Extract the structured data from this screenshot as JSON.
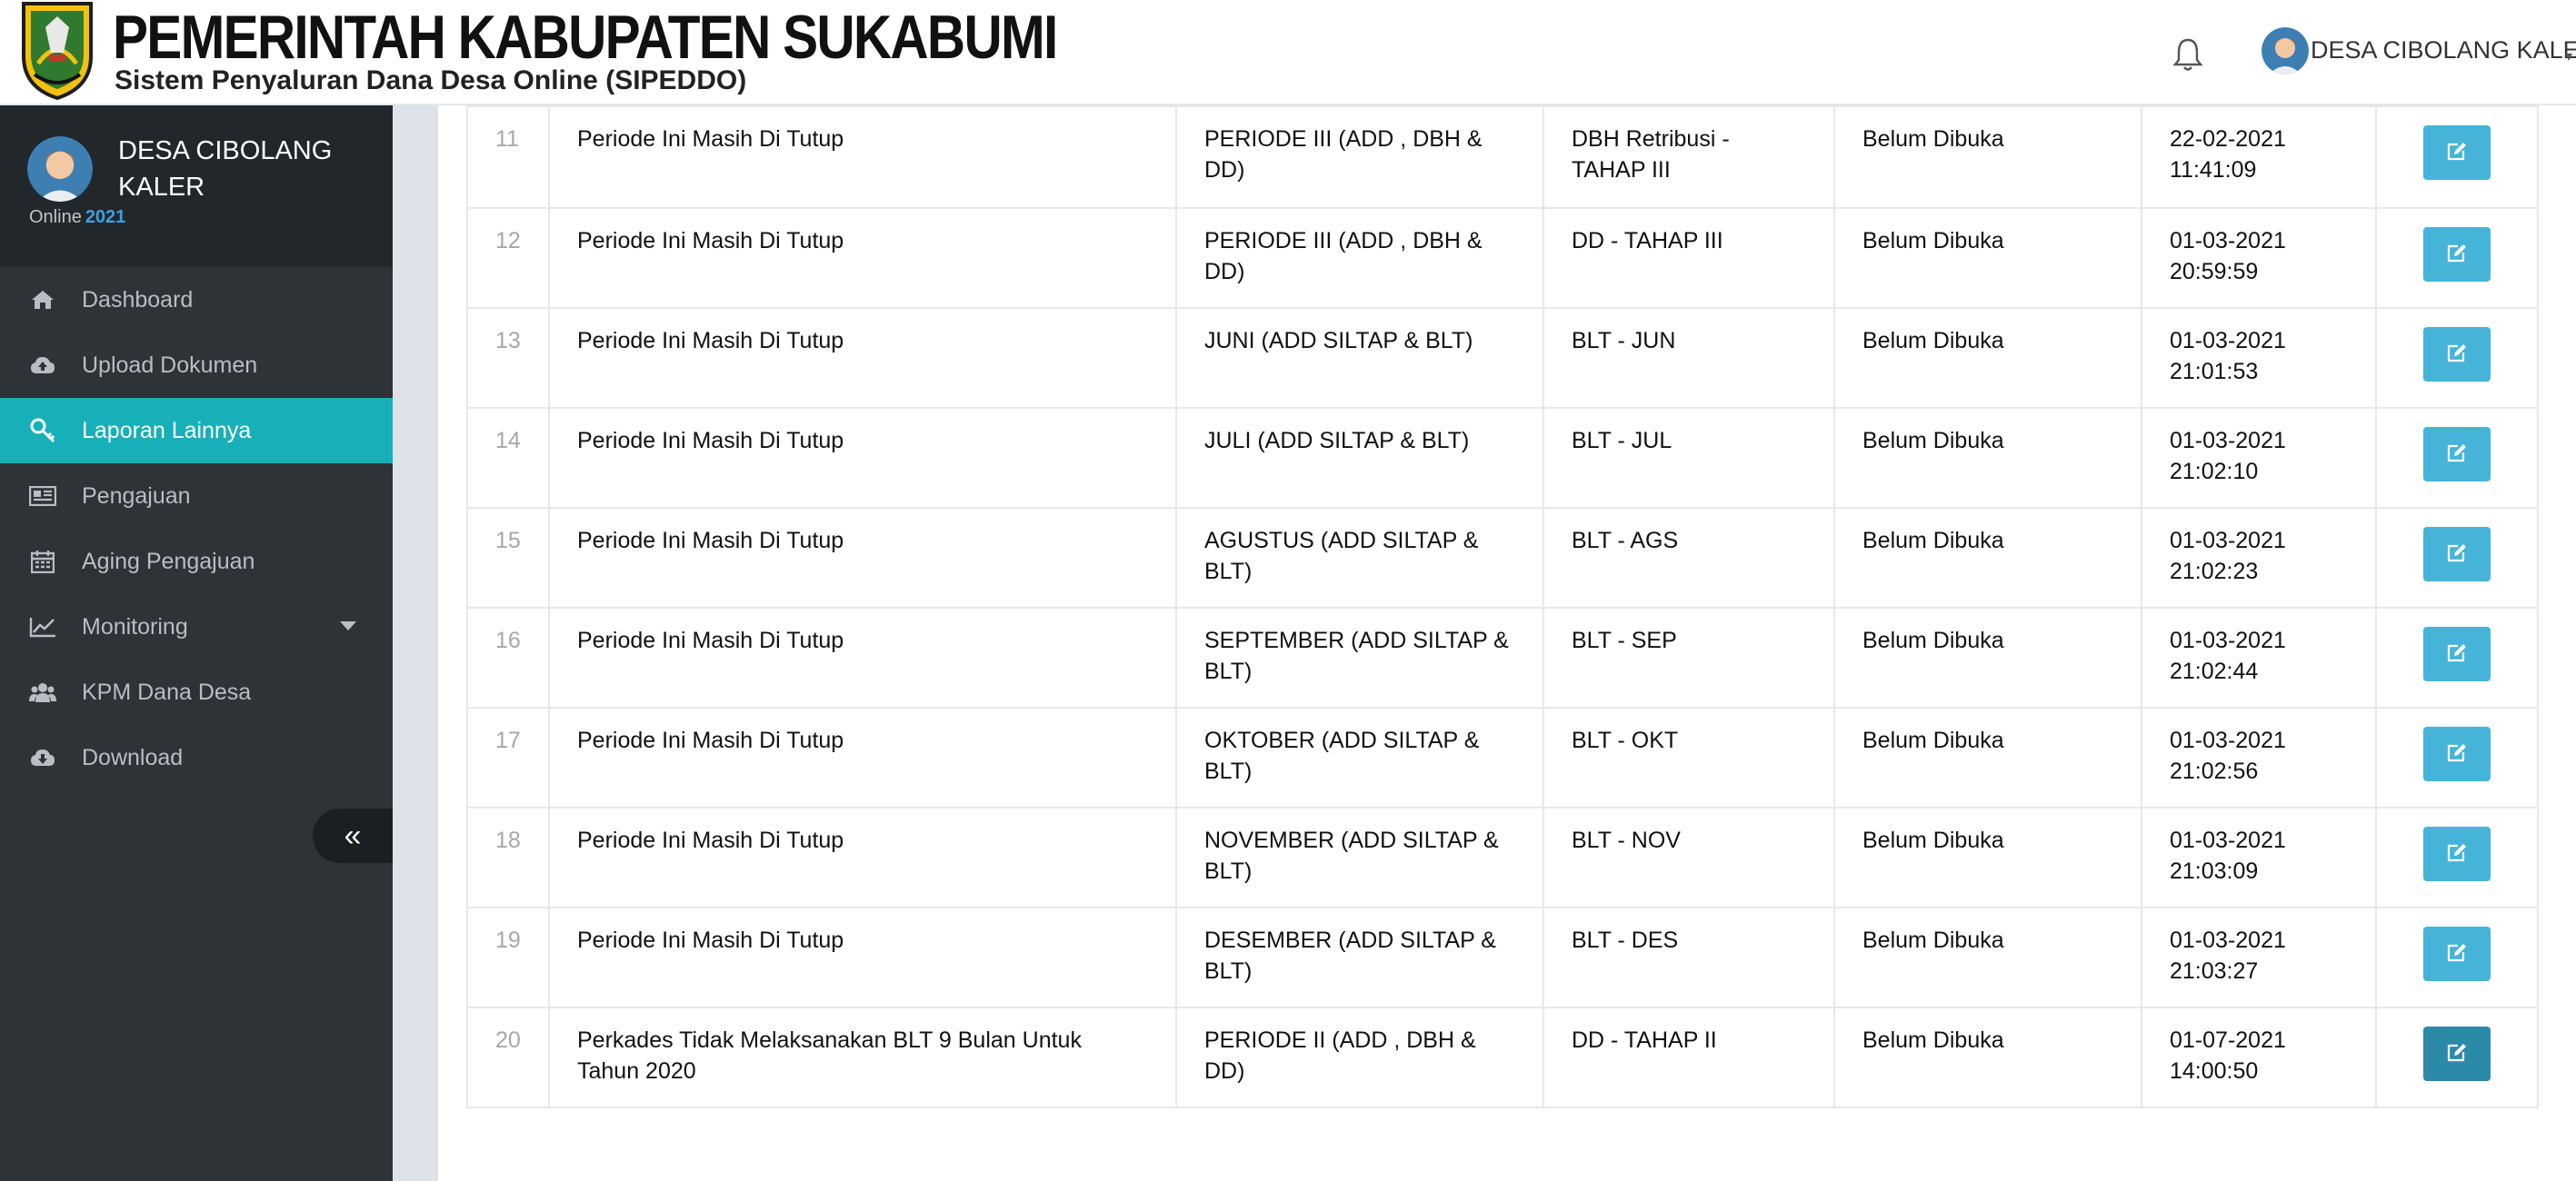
{
  "header": {
    "title": "PEMERINTAH KABUPATEN SUKABUMI",
    "subtitle": "Sistem Penyaluran Dana Desa Online (SIPEDDO)",
    "user_name": "DESA CIBOLANG KALER",
    "icons": [
      "logo-emblem",
      "bell-icon",
      "user-avatar",
      "caret-down-icon"
    ]
  },
  "sidebar": {
    "profile_name": "DESA CIBOLANG KALER",
    "online_label": "Online",
    "year": "2021",
    "items": [
      {
        "label": "Dashboard",
        "icon": "home-icon"
      },
      {
        "label": "Upload Dokumen",
        "icon": "cloud-upload-icon"
      },
      {
        "label": "Laporan Lainnya",
        "icon": "key-icon",
        "active": true
      },
      {
        "label": "Pengajuan",
        "icon": "newspaper-icon"
      },
      {
        "label": "Aging Pengajuan",
        "icon": "calendar-icon"
      },
      {
        "label": "Monitoring",
        "icon": "line-chart-icon"
      },
      {
        "label": "KPM Dana Desa",
        "icon": "users-icon"
      },
      {
        "label": "Download",
        "icon": "cloud-download-icon"
      }
    ],
    "collapse_label": "«"
  },
  "table": {
    "rows": [
      {
        "no": "11",
        "keterangan": "Periode Ini Masih Di Tutup",
        "periode": "PERIODE III (ADD , DBH & DD)",
        "jenis": "DBH Retribusi - TAHAP III",
        "status": "Belum Dibuka",
        "tanggal": "22-02-2021",
        "jam": "11:41:09"
      },
      {
        "no": "12",
        "keterangan": "Periode Ini Masih Di Tutup",
        "periode": "PERIODE III (ADD , DBH & DD)",
        "jenis": "DD - TAHAP III",
        "status": "Belum Dibuka",
        "tanggal": "01-03-2021",
        "jam": "20:59:59"
      },
      {
        "no": "13",
        "keterangan": "Periode Ini Masih Di Tutup",
        "periode": "JUNI (ADD SILTAP & BLT)",
        "jenis": "BLT - JUN",
        "status": "Belum Dibuka",
        "tanggal": "01-03-2021",
        "jam": "21:01:53"
      },
      {
        "no": "14",
        "keterangan": "Periode Ini Masih Di Tutup",
        "periode": "JULI (ADD SILTAP & BLT)",
        "jenis": "BLT - JUL",
        "status": "Belum Dibuka",
        "tanggal": "01-03-2021",
        "jam": "21:02:10"
      },
      {
        "no": "15",
        "keterangan": "Periode Ini Masih Di Tutup",
        "periode": "AGUSTUS (ADD SILTAP & BLT)",
        "jenis": "BLT - AGS",
        "status": "Belum Dibuka",
        "tanggal": "01-03-2021",
        "jam": "21:02:23"
      },
      {
        "no": "16",
        "keterangan": "Periode Ini Masih Di Tutup",
        "periode": "SEPTEMBER (ADD SILTAP & BLT)",
        "jenis": "BLT - SEP",
        "status": "Belum Dibuka",
        "tanggal": "01-03-2021",
        "jam": "21:02:44"
      },
      {
        "no": "17",
        "keterangan": "Periode Ini Masih Di Tutup",
        "periode": "OKTOBER (ADD SILTAP & BLT)",
        "jenis": "BLT - OKT",
        "status": "Belum Dibuka",
        "tanggal": "01-03-2021",
        "jam": "21:02:56"
      },
      {
        "no": "18",
        "keterangan": "Periode Ini Masih Di Tutup",
        "periode": "NOVEMBER (ADD SILTAP & BLT)",
        "jenis": "BLT - NOV",
        "status": "Belum Dibuka",
        "tanggal": "01-03-2021",
        "jam": "21:03:09"
      },
      {
        "no": "19",
        "keterangan": "Periode Ini Masih Di Tutup",
        "periode": "DESEMBER (ADD SILTAP & BLT)",
        "jenis": "BLT - DES",
        "status": "Belum Dibuka",
        "tanggal": "01-03-2021",
        "jam": "21:03:27"
      },
      {
        "no": "20",
        "keterangan": "Perkades Tidak Melaksanakan BLT 9 Bulan Untuk Tahun 2020",
        "periode": "PERIODE II (ADD , DBH & DD)",
        "jenis": "DD - TAHAP II",
        "status": "Belum Dibuka",
        "tanggal": "01-07-2021",
        "jam": "14:00:50"
      }
    ],
    "action_icon": "edit-icon"
  },
  "colors": {
    "sidebar_bg": "#2e3338",
    "sidebar_active": "#18b0b8",
    "edit_button": "#45b4d8",
    "edit_button_hover": "#2b8aa8",
    "year_accent": "#3ca0e0"
  }
}
